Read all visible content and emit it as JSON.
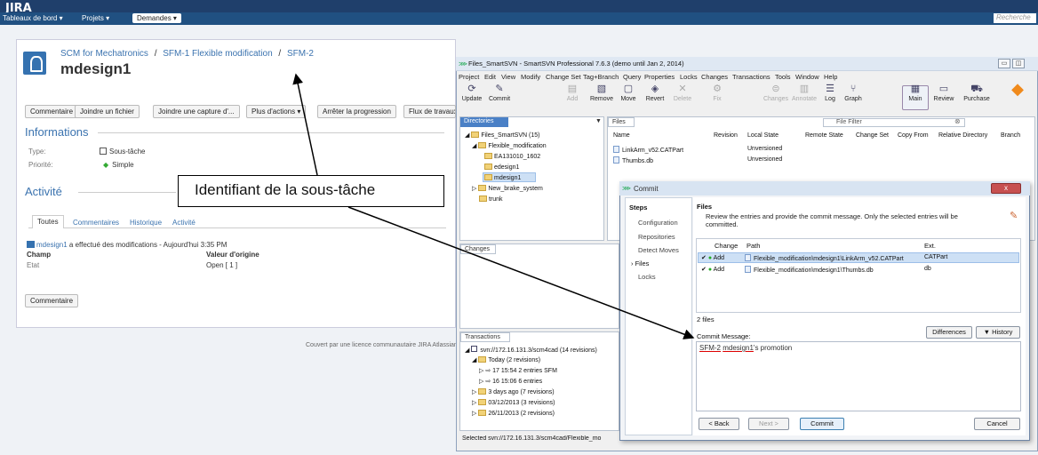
{
  "jira": {
    "logo": "JIRA",
    "nav": {
      "dashboards": "Tableaux de bord ▾",
      "projects": "Projets ▾",
      "requests": "Demandes ▾",
      "search_placeholder": "Recherche"
    },
    "breadcrumb": {
      "project": "SCM for Mechatronics",
      "sep1": "/",
      "parent": "SFM-1 Flexible modification",
      "sep2": "/",
      "key": "SFM-2"
    },
    "issue_title": "mdesign1",
    "buttons": [
      "Commentaire",
      "Joindre un fichier",
      "Joindre une capture d'...",
      "Plus d'actions ▾",
      "Arrêter la progression",
      "Flux de travaux"
    ],
    "info": {
      "heading": "Informations",
      "type_label": "Type:",
      "type_value": "Sous-tâche",
      "priority_label": "Priorité:",
      "priority_value": "Simple"
    },
    "activity": {
      "heading": "Activité",
      "tabs": [
        "Toutes",
        "Commentaires",
        "Historique",
        "Activité"
      ],
      "entry_user": "mdesign1",
      "entry_text": "a effectué des modifications - Aujourd'hui 3:35 PM",
      "col_field": "Champ",
      "col_original": "Valeur d'origine",
      "field": "Etat",
      "original": "Open [ 1 ]"
    },
    "comment_button": "Commentaire",
    "footer": "Couvert par une licence communautaire JIRA Atlassian"
  },
  "callout": {
    "text": "Identifiant de la sous-tâche"
  },
  "svn": {
    "title": "Files_SmartSVN - SmartSVN Professional 7.6.3 (demo until Jan 2, 2014)",
    "menu": [
      "Project",
      "Edit",
      "View",
      "Modify",
      "Change Set",
      "Tag+Branch",
      "Query",
      "Properties",
      "Locks",
      "Changes",
      "Transactions",
      "Tools",
      "Window",
      "Help"
    ],
    "toolbar": [
      "Update",
      "Commit",
      "Add",
      "Remove",
      "Move",
      "Revert",
      "Delete",
      "Fix",
      "Changes",
      "Annotate",
      "Log",
      "Graph",
      "Main",
      "Review",
      "Purchase"
    ],
    "directories": {
      "tab": "Directories",
      "items": [
        "Files_SmartSVN (15)",
        "Flexible_modification",
        "EA131010_1602",
        "edesign1",
        "mdesign1",
        "New_brake_system",
        "trunk"
      ]
    },
    "files": {
      "tab": "Files",
      "filter": "File Filter",
      "columns": [
        "Name",
        "Revision",
        "Local State",
        "Remote State",
        "Change Set",
        "Copy From",
        "Relative Directory",
        "Branch"
      ],
      "rows": [
        {
          "name": "LinkArm_v52.CATPart",
          "state": "Unversioned"
        },
        {
          "name": "Thumbs.db",
          "state": "Unversioned"
        }
      ]
    },
    "changes_tab": "Changes",
    "transactions": {
      "tab": "Transactions",
      "items": [
        "svn://172.16.131.3/scm4cad (14 revisions)",
        "Today (2 revisions)",
        "17  15:54    2  entries  SFM",
        "16  15:06    6  entries",
        "3 days ago (7 revisions)",
        "03/12/2013 (3 revisions)",
        "26/11/2013 (2 revisions)"
      ]
    },
    "status": "Selected svn://172.16.131.3/scm4cad/Flexible_mo"
  },
  "commit": {
    "title": "Commit",
    "close": "x",
    "steps_heading": "Steps",
    "steps": [
      "Configuration",
      "Repositories",
      "Detect Moves",
      "Files",
      "Locks"
    ],
    "files_heading": "Files",
    "description": "Review the entries and provide the commit message. Only the selected entries will be committed.",
    "columns": [
      "Change",
      "Path",
      "Ext."
    ],
    "rows": [
      {
        "change": "Add",
        "path": "Flexible_modification\\mdesign1\\LinkArm_v52.CATPart",
        "ext": "CATPart"
      },
      {
        "change": "Add",
        "path": "Flexible_modification\\mdesign1\\Thumbs.db",
        "ext": "db"
      }
    ],
    "count": "2 files",
    "differences": "Differences",
    "history": "▼ History",
    "message_label": "Commit Message:",
    "message_key": "SFM-2",
    "message_user": "mdesign1",
    "message_rest": "'s promotion",
    "back": "< Back",
    "next": "Next >",
    "commit": "Commit",
    "cancel": "Cancel"
  }
}
